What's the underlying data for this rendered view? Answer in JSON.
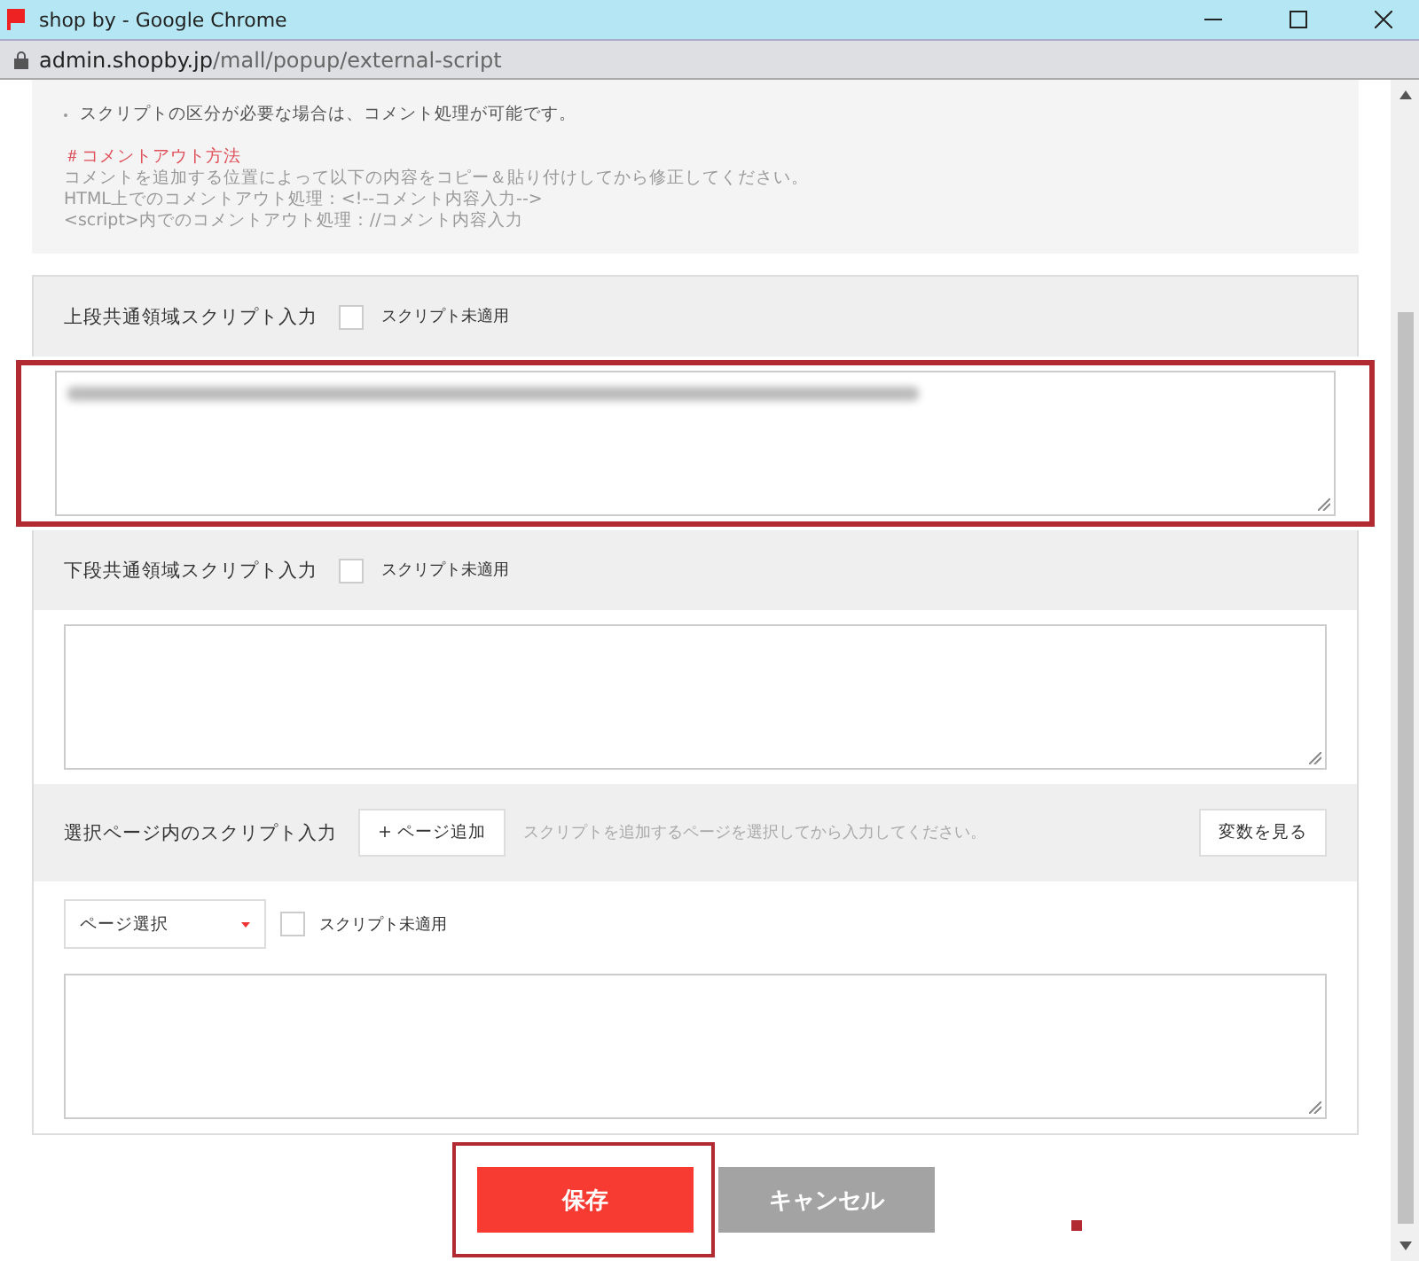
{
  "window": {
    "title": "shop by - Google Chrome",
    "url_host": "admin.shopby.jp",
    "url_path": "/mall/popup/external-script"
  },
  "notes": {
    "bullet": "スクリプトの区分が必要な場合は、コメント処理が可能です。",
    "heading": "＃コメントアウト方法",
    "lines": [
      "コメントを追加する位置によって以下の内容をコピー＆貼り付けしてから修正してください。",
      "HTML上でのコメントアウト処理：<!--コメント内容入力-->",
      "<script>内でのコメントアウト処理：//コメント内容入力"
    ]
  },
  "sections": [
    {
      "kind": "common",
      "label": "上段共通領域スクリプト入力",
      "checkbox_label": "スクリプト未適用",
      "checked": false,
      "highlighted": true,
      "has_content": true
    },
    {
      "kind": "common",
      "label": "下段共通領域スクリプト入力",
      "checkbox_label": "スクリプト未適用",
      "checked": false,
      "highlighted": false,
      "has_content": false
    },
    {
      "kind": "page",
      "label": "選択ページ内のスクリプト入力",
      "add_button": "+ ページ追加",
      "hint": "スクリプトを追加するページを選択してから入力してください。",
      "vars_button": "変数を見る",
      "select": "ページ選択",
      "checkbox_label": "スクリプト未適用",
      "checked": false,
      "highlighted": false,
      "has_content": false
    }
  ],
  "buttons": [
    {
      "label": "保存",
      "kind": "primary",
      "highlighted": true
    },
    {
      "label": "キャンセル",
      "kind": "secondary",
      "highlighted": false
    }
  ]
}
